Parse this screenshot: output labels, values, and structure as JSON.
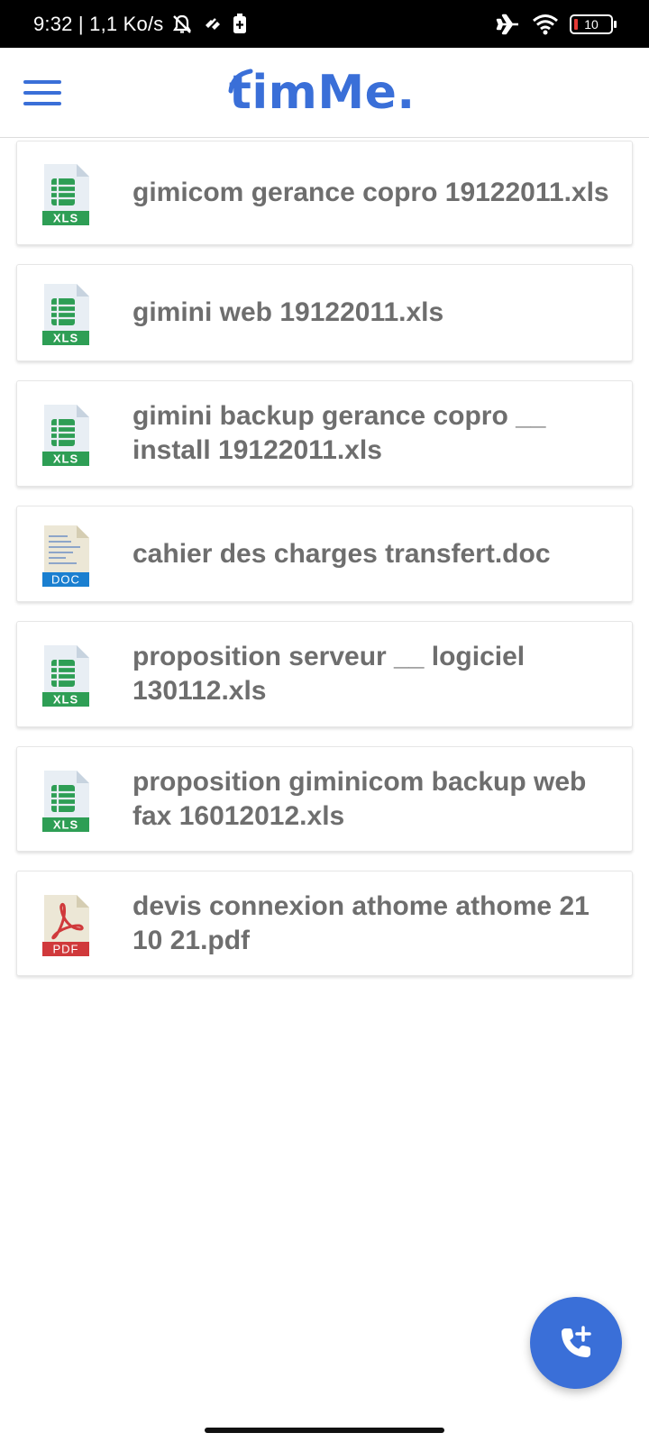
{
  "status_bar": {
    "time_speed": "9:32 | 1,1 Ko/s",
    "battery_level": "10"
  },
  "app_bar": {
    "logo_text": "timMe.",
    "accent_color": "#3a6fd8"
  },
  "files": [
    {
      "name": "gimicom gerance copro 19122011.xls",
      "type": "XLS"
    },
    {
      "name": "gimini web 19122011.xls",
      "type": "XLS"
    },
    {
      "name": "gimini backup gerance copro __ install 19122011.xls",
      "type": "XLS"
    },
    {
      "name": "cahier des charges transfert.doc",
      "type": "DOC"
    },
    {
      "name": "proposition serveur __ logiciel 130112.xls",
      "type": "XLS"
    },
    {
      "name": "proposition giminicom backup web fax 16012012.xls",
      "type": "XLS"
    },
    {
      "name": "devis connexion athome athome 21 10 21.pdf",
      "type": "PDF"
    }
  ],
  "icons": {
    "menu": "hamburger-menu-icon",
    "fab": "add-call-icon",
    "status": [
      "do-not-disturb-icon",
      "link-icon",
      "sim-icon",
      "airplane-icon",
      "wifi-icon",
      "battery-icon"
    ]
  }
}
